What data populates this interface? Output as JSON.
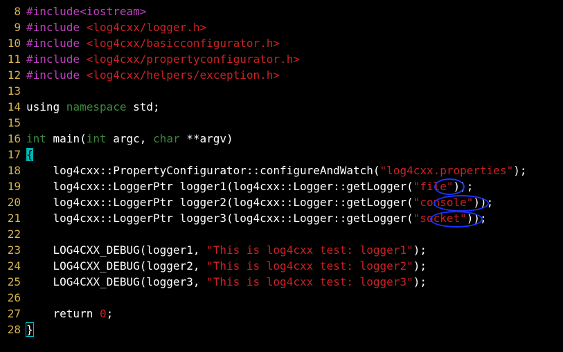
{
  "editor": {
    "colors": {
      "background": "#000000",
      "line_number": "#d7b64d",
      "preprocessor": "#c040c0",
      "string": "#cc2222",
      "keyword": "#3a8a3a",
      "text": "#ffffff",
      "cursor": "#00b7b7",
      "annotation_oval": "#1a33ff"
    },
    "lines": [
      {
        "num": "8",
        "tokens": [
          {
            "t": "#include<iostream>",
            "c": "pp"
          }
        ]
      },
      {
        "num": "9",
        "tokens": [
          {
            "t": "#include ",
            "c": "pp"
          },
          {
            "t": "<log4cxx/logger.h>",
            "c": "str"
          }
        ]
      },
      {
        "num": "10",
        "tokens": [
          {
            "t": "#include ",
            "c": "pp"
          },
          {
            "t": "<log4cxx/basicconfigurator.h>",
            "c": "str"
          }
        ]
      },
      {
        "num": "11",
        "tokens": [
          {
            "t": "#include ",
            "c": "pp"
          },
          {
            "t": "<log4cxx/propertyconfigurator.h>",
            "c": "str"
          }
        ]
      },
      {
        "num": "12",
        "tokens": [
          {
            "t": "#include ",
            "c": "pp"
          },
          {
            "t": "<log4cxx/helpers/exception.h>",
            "c": "str"
          }
        ]
      },
      {
        "num": "13",
        "tokens": []
      },
      {
        "num": "14",
        "tokens": [
          {
            "t": "using ",
            "c": "txt"
          },
          {
            "t": "namespace",
            "c": "kw"
          },
          {
            "t": " std;",
            "c": "txt"
          }
        ]
      },
      {
        "num": "15",
        "tokens": []
      },
      {
        "num": "16",
        "tokens": [
          {
            "t": "int",
            "c": "kw"
          },
          {
            "t": " main(",
            "c": "txt"
          },
          {
            "t": "int",
            "c": "kw"
          },
          {
            "t": " argc, ",
            "c": "txt"
          },
          {
            "t": "char",
            "c": "kw"
          },
          {
            "t": " **argv)",
            "c": "txt"
          }
        ]
      },
      {
        "num": "17",
        "tokens": [
          {
            "t": "{",
            "c": "cursor"
          }
        ]
      },
      {
        "num": "18",
        "tokens": [
          {
            "t": "    log4cxx::PropertyConfigurator::configureAndWatch(",
            "c": "txt"
          },
          {
            "t": "\"log4cxx.properties\"",
            "c": "str"
          },
          {
            "t": ");",
            "c": "txt"
          }
        ]
      },
      {
        "num": "19",
        "tokens": [
          {
            "t": "    log4cxx::LoggerPtr logger1(log4cxx::Logger::getLogger(",
            "c": "txt"
          },
          {
            "t": "\"file\"",
            "c": "str"
          },
          {
            "t": "));",
            "c": "txt"
          }
        ]
      },
      {
        "num": "20",
        "tokens": [
          {
            "t": "    log4cxx::LoggerPtr logger2(log4cxx::Logger::getLogger(",
            "c": "txt"
          },
          {
            "t": "\"console\"",
            "c": "str"
          },
          {
            "t": "));",
            "c": "txt"
          }
        ]
      },
      {
        "num": "21",
        "tokens": [
          {
            "t": "    log4cxx::LoggerPtr logger3(log4cxx::Logger::getLogger(",
            "c": "txt"
          },
          {
            "t": "\"socket\"",
            "c": "str"
          },
          {
            "t": "));",
            "c": "txt"
          }
        ]
      },
      {
        "num": "22",
        "tokens": []
      },
      {
        "num": "23",
        "tokens": [
          {
            "t": "    LOG4CXX_DEBUG(logger1, ",
            "c": "txt"
          },
          {
            "t": "\"This is log4cxx test: logger1\"",
            "c": "str"
          },
          {
            "t": ");",
            "c": "txt"
          }
        ]
      },
      {
        "num": "24",
        "tokens": [
          {
            "t": "    LOG4CXX_DEBUG(logger2, ",
            "c": "txt"
          },
          {
            "t": "\"This is log4cxx test: logger2\"",
            "c": "str"
          },
          {
            "t": ");",
            "c": "txt"
          }
        ]
      },
      {
        "num": "25",
        "tokens": [
          {
            "t": "    LOG4CXX_DEBUG(logger3, ",
            "c": "txt"
          },
          {
            "t": "\"This is log4cxx test: logger3\"",
            "c": "str"
          },
          {
            "t": ");",
            "c": "txt"
          }
        ]
      },
      {
        "num": "26",
        "tokens": []
      },
      {
        "num": "27",
        "tokens": [
          {
            "t": "    return ",
            "c": "txt"
          },
          {
            "t": "0",
            "c": "num"
          },
          {
            "t": ";",
            "c": "txt"
          }
        ]
      },
      {
        "num": "28",
        "tokens": [
          {
            "t": "}",
            "c": "match"
          }
        ]
      }
    ]
  }
}
